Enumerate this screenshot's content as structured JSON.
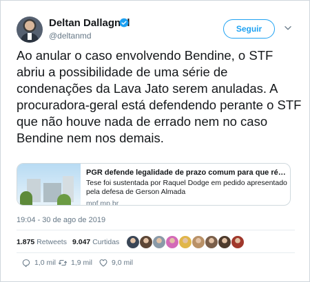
{
  "author": {
    "name": "Deltan Dallagnol",
    "handle": "@deltanmd"
  },
  "follow_label": "Seguir",
  "tweet_text": "Ao anular o caso envolvendo Bendine, o STF abriu a possibilidade de uma série de condenações da Lava Jato serem anuladas. A procuradora-geral está defendendo perante o STF que não houve nada de errado nem no caso Bendine nem nos demais.",
  "card": {
    "title": "PGR defende legalidade de prazo comum para que réus col...",
    "description": "Tese foi sustentada por Raquel Dodge em pedido apresentado pela defesa de Gerson Almada",
    "domain": "mpf.mp.br"
  },
  "timestamp": "19:04 - 30 de ago de 2019",
  "stats": {
    "retweets_count": "1.875",
    "retweets_label": "Retweets",
    "likes_count": "9.047",
    "likes_label": "Curtidas"
  },
  "liker_colors": [
    "#3a4656",
    "#5c4636",
    "#8a9aa8",
    "#d36ab8",
    "#e0b64a",
    "#b99167",
    "#7a5f4a",
    "#4d3a2c",
    "#a0382c"
  ],
  "actions": {
    "reply_count": "1,0 mil",
    "retweet_count": "1,9 mil",
    "like_count": "9,0 mil"
  },
  "colors": {
    "accent": "#1da1f2",
    "secondary_text": "#657786"
  },
  "icons": [
    "verified-badge-icon",
    "chevron-down-icon",
    "reply-icon",
    "retweet-icon",
    "like-icon"
  ]
}
